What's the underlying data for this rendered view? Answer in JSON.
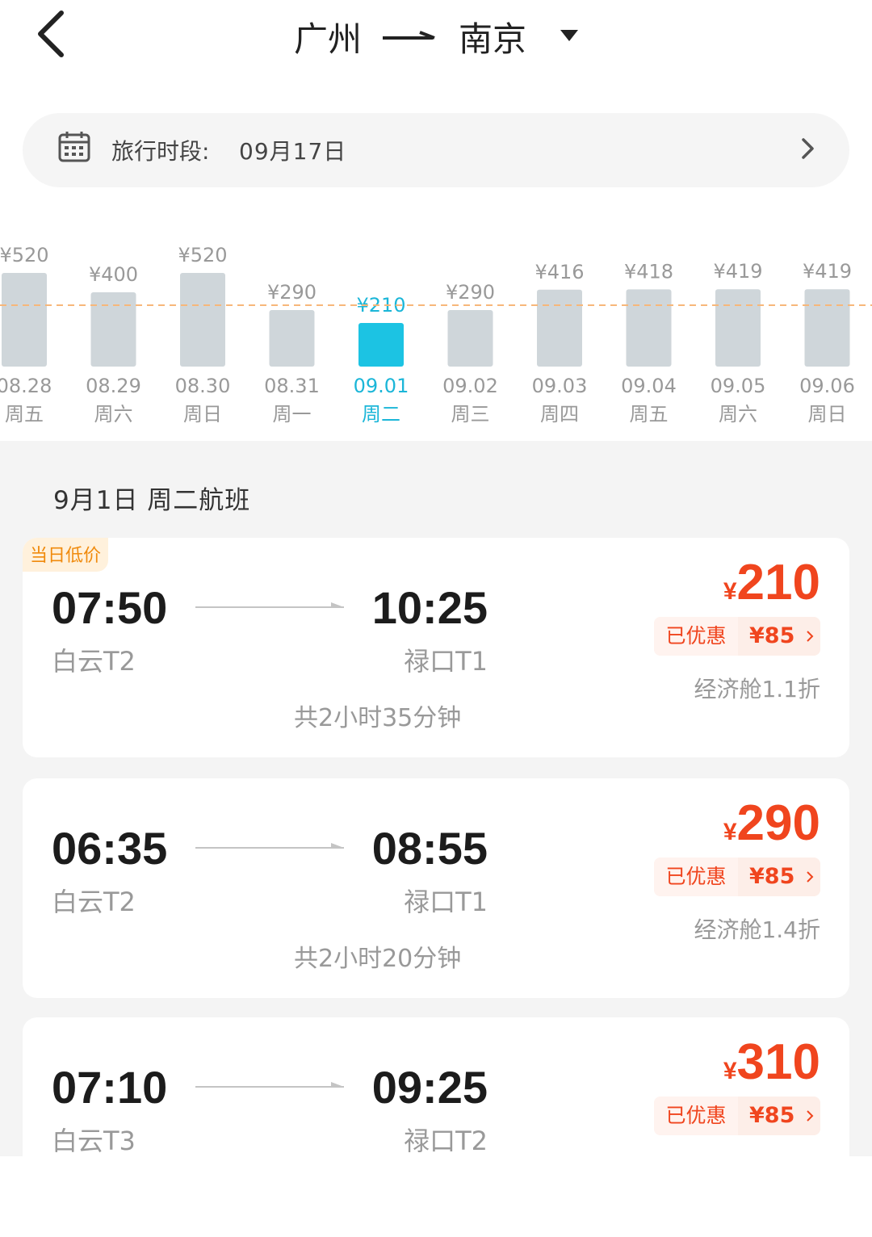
{
  "header": {
    "origin": "广州",
    "destination": "南京"
  },
  "travel_period": {
    "label": "旅行时段:",
    "value": "09月17日"
  },
  "price_trend": {
    "selected_index": 4,
    "reference_line_price": 320,
    "days": [
      {
        "price_label": "¥520",
        "price": 520,
        "date": "08.28",
        "weekday": "周五"
      },
      {
        "price_label": "¥400",
        "price": 400,
        "date": "08.29",
        "weekday": "周六"
      },
      {
        "price_label": "¥520",
        "price": 520,
        "date": "08.30",
        "weekday": "周日"
      },
      {
        "price_label": "¥290",
        "price": 290,
        "date": "08.31",
        "weekday": "周一"
      },
      {
        "price_label": "¥210",
        "price": 210,
        "date": "09.01",
        "weekday": "周二"
      },
      {
        "price_label": "¥290",
        "price": 290,
        "date": "09.02",
        "weekday": "周三"
      },
      {
        "price_label": "¥416",
        "price": 416,
        "date": "09.03",
        "weekday": "周四"
      },
      {
        "price_label": "¥418",
        "price": 418,
        "date": "09.04",
        "weekday": "周五"
      },
      {
        "price_label": "¥419",
        "price": 419,
        "date": "09.05",
        "weekday": "周六"
      },
      {
        "price_label": "¥419",
        "price": 419,
        "date": "09.06",
        "weekday": "周日"
      }
    ],
    "colors": {
      "bar": "#cfd6da",
      "selected_bar": "#1cc3e3",
      "selected_text": "#1bb6d8",
      "text": "#999999",
      "reference_line": "#f7b77a"
    }
  },
  "flights_section": {
    "title": "9月1日 周二航班",
    "flights": [
      {
        "tag": "当日低价",
        "dep_time": "07:50",
        "arr_time": "10:25",
        "dep_airport": "白云T2",
        "arr_airport": "禄口T1",
        "duration": "共2小时35分钟",
        "currency": "¥",
        "price": "210",
        "discount_label": "已优惠",
        "discount_value": "¥85",
        "cabin": "经济舱1.1折"
      },
      {
        "tag": "",
        "dep_time": "06:35",
        "arr_time": "08:55",
        "dep_airport": "白云T2",
        "arr_airport": "禄口T1",
        "duration": "共2小时20分钟",
        "currency": "¥",
        "price": "290",
        "discount_label": "已优惠",
        "discount_value": "¥85",
        "cabin": "经济舱1.4折"
      },
      {
        "tag": "",
        "dep_time": "07:10",
        "arr_time": "09:25",
        "dep_airport": "白云T3",
        "arr_airport": "禄口T2",
        "duration": "",
        "currency": "¥",
        "price": "310",
        "discount_label": "已优惠",
        "discount_value": "¥85",
        "cabin": ""
      }
    ]
  },
  "accent_color": "#f0451e"
}
